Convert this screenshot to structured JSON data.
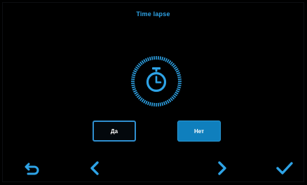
{
  "header": {
    "title": "Time lapse"
  },
  "timer": {
    "icon": "stopwatch-icon"
  },
  "dialog": {
    "yes_label": "Да",
    "no_label": "Нет",
    "selected": "no"
  },
  "navigation": {
    "back_icon": "return-arrow-icon",
    "prev_icon": "chevron-left-icon",
    "next_icon": "chevron-right-icon",
    "confirm_icon": "checkmark-icon"
  },
  "colors": {
    "background": "#000000",
    "accent": "#2ea3e6",
    "selected_button": "#0f7fbd",
    "text": "#ffffff"
  }
}
